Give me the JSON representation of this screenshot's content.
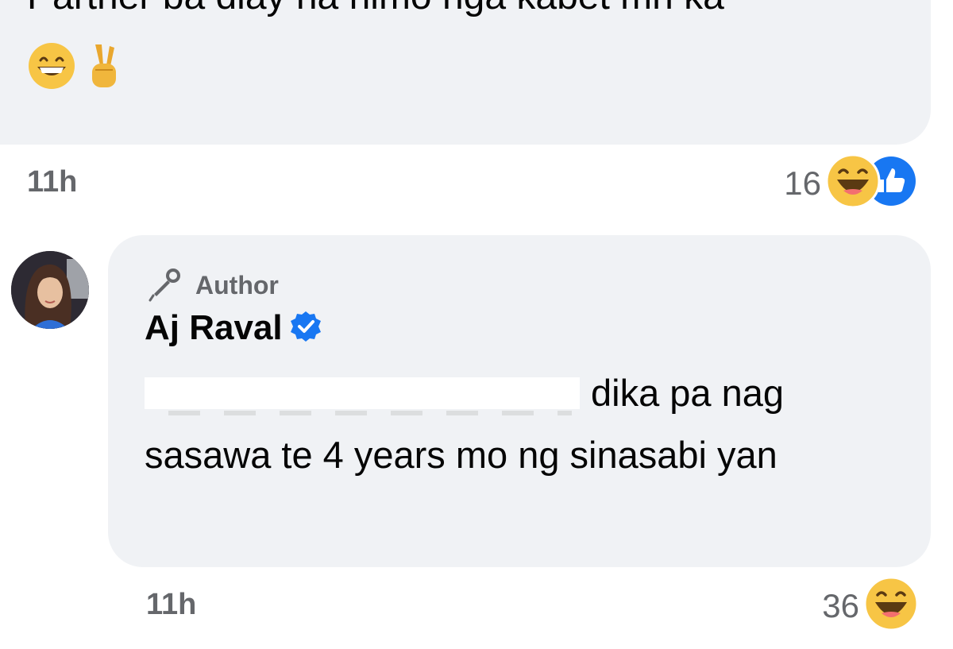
{
  "parent_comment": {
    "text": "Partner ba diay na nimo nga kabet mn ka",
    "emojis": [
      "grinning-face-icon",
      "victory-hand-icon"
    ],
    "timestamp": "11h",
    "reaction_count": "16",
    "reactions": [
      "haha-reaction-icon",
      "like-reaction-icon"
    ]
  },
  "reply": {
    "badge_label": "Author",
    "badge_icon": "microphone-icon",
    "name": "Aj Raval",
    "verified_icon": "verified-badge-icon",
    "verified_color": "#1877f2",
    "body_text": "dika pa nag sasawa te 4 years mo ng sinasabi yan",
    "timestamp": "11h",
    "reaction_count": "36",
    "reactions": [
      "haha-reaction-icon"
    ]
  },
  "colors": {
    "bubble": "#f0f2f5",
    "secondary_text": "#65676b",
    "like_blue": "#1877f2",
    "haha_yellow": "#f7c545"
  }
}
